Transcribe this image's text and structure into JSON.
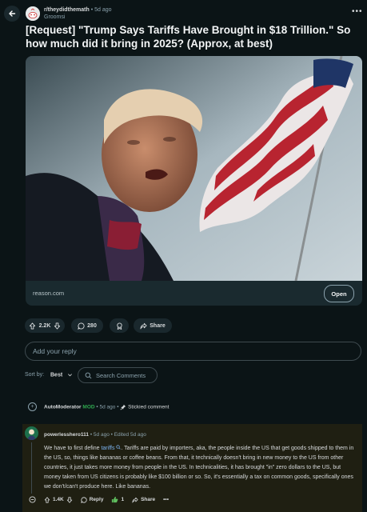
{
  "header": {
    "subreddit": "r/theydidthemath",
    "separator": "•",
    "time": "5d ago",
    "author": "Groomsi",
    "more": "•••"
  },
  "post": {
    "title": "[Request] \"Trump Says Tariffs Have Brought in $18 Trillion.\" So how much did it bring in 2025? (Approx, at best)",
    "link_domain": "reason.com",
    "open_label": "Open",
    "upvotes": "2.2K",
    "comments": "280",
    "share_label": "Share"
  },
  "reply": {
    "placeholder": "Add your reply"
  },
  "sort": {
    "label": "Sort by:",
    "selected": "Best",
    "search_placeholder": "Search Comments"
  },
  "automod": {
    "name": "AutoModerator",
    "badge": "MOD",
    "separator": "•",
    "time": "5d ago",
    "stickied": "Stickied comment"
  },
  "comment": {
    "author": "powerlesshero111",
    "separator": "•",
    "time": "5d ago",
    "edited": "Edited 5d ago",
    "body_pre": "We have to first define ",
    "body_link": "tariffs",
    "body_post": ". Tariffs are paid by importers, aka, the people inside the US that get goods shipped to them in the US, so, things like bananas or coffee beans. From that, it technically doesn't bring in new money to the US from other countries, it just takes more money from people in the US. In technicalities, it has brought \"in\" zero dollars to the US, but money taken from US citizens is probably like $100 billion or so. So, it's essentially a tax on common goods, specifically ones we don't/can't produce here. Like bananas.",
    "upvotes": "1.4K",
    "reply_label": "Reply",
    "award_count": "1",
    "share_label": "Share",
    "more": "•••"
  },
  "colors": {
    "background": "#0b1416",
    "mod_green": "#2fa84f",
    "link_blue": "#7bb3f0"
  }
}
